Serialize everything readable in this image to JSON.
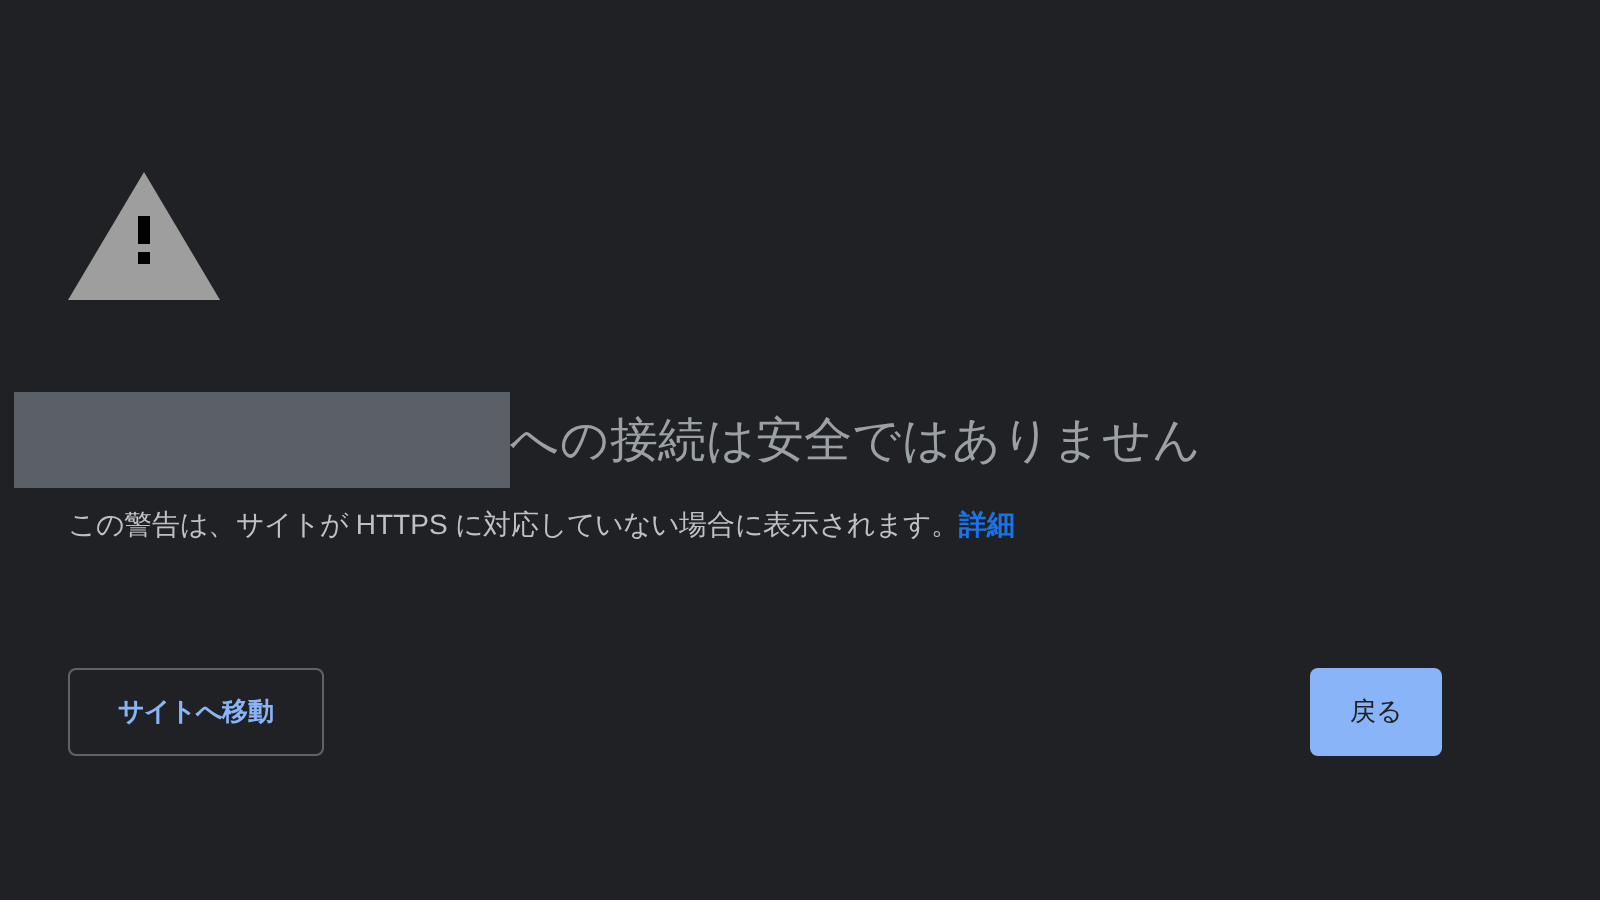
{
  "heading": "への接続は安全ではありません",
  "message": {
    "text": "この警告は、サイトが HTTPS に対応していない場合に表示されます。",
    "link": "詳細"
  },
  "buttons": [
    {
      "label": "サイトへ移動",
      "kind": "secondary"
    },
    {
      "label": "戻る",
      "kind": "primary"
    }
  ]
}
